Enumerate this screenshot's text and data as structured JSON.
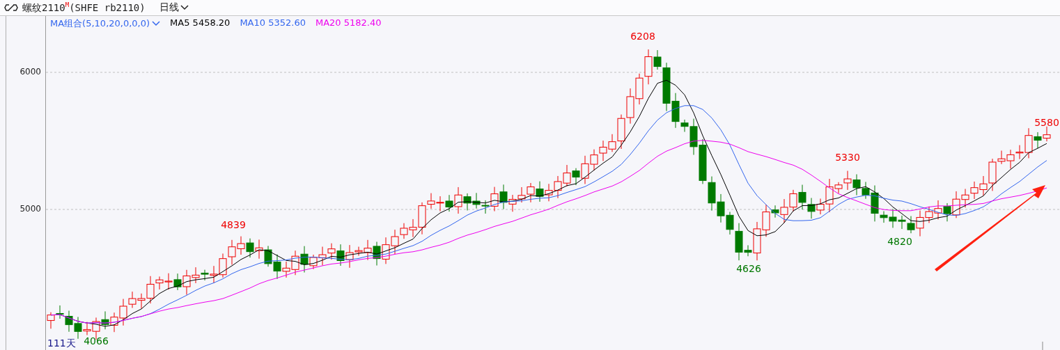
{
  "header": {
    "name": "螺纹2110",
    "marker": "M",
    "code": "(SHFE rb2110)",
    "period": "日线"
  },
  "legend": {
    "group": "MA组合(5,10,20,0,0,0)",
    "items": [
      {
        "label": "MA5 5458.20",
        "color": "#000000"
      },
      {
        "label": "MA10 5352.60",
        "color": "#3366ee"
      },
      {
        "label": "MA20 5182.40",
        "color": "#ee00ee"
      }
    ]
  },
  "axis": {
    "ticks": [
      "6000",
      "5000"
    ]
  },
  "price_labels": [
    {
      "text": "4839",
      "kind": "high"
    },
    {
      "text": "6208",
      "kind": "high"
    },
    {
      "text": "4626",
      "kind": "low"
    },
    {
      "text": "5330",
      "kind": "high"
    },
    {
      "text": "4820",
      "kind": "low"
    },
    {
      "text": "5580",
      "kind": "high"
    },
    {
      "text": "4066",
      "kind": "low"
    }
  ],
  "footer": {
    "days": "111天"
  }
}
